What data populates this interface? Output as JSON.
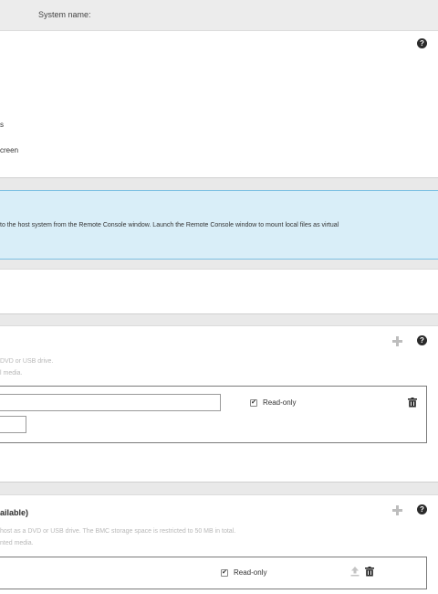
{
  "header": {
    "system_name_label": "System name:"
  },
  "panel1": {
    "line1": "s",
    "line2": "creen"
  },
  "info": {
    "message": "to the host system from the Remote Console window. Launch the Remote Console window to mount local files as virtual"
  },
  "panel_virtual": {
    "desc1": "DVD or USB drive.",
    "desc2": "l media.",
    "readonly_label": "Read-only",
    "readonly_checked": true
  },
  "panel_bmc": {
    "title": "ailable)",
    "desc1": "host as a DVD or USB drive. The BMC storage space is restricted to 50 MB in total.",
    "desc2": "nted media.",
    "readonly_label": "Read-only",
    "readonly_checked": true
  },
  "icons": {
    "help": "help-icon",
    "add": "plus-icon",
    "delete": "trash-icon",
    "upload": "upload-icon",
    "check": "checkmark-icon"
  },
  "check_glyph": "✔",
  "help_glyph": "?"
}
